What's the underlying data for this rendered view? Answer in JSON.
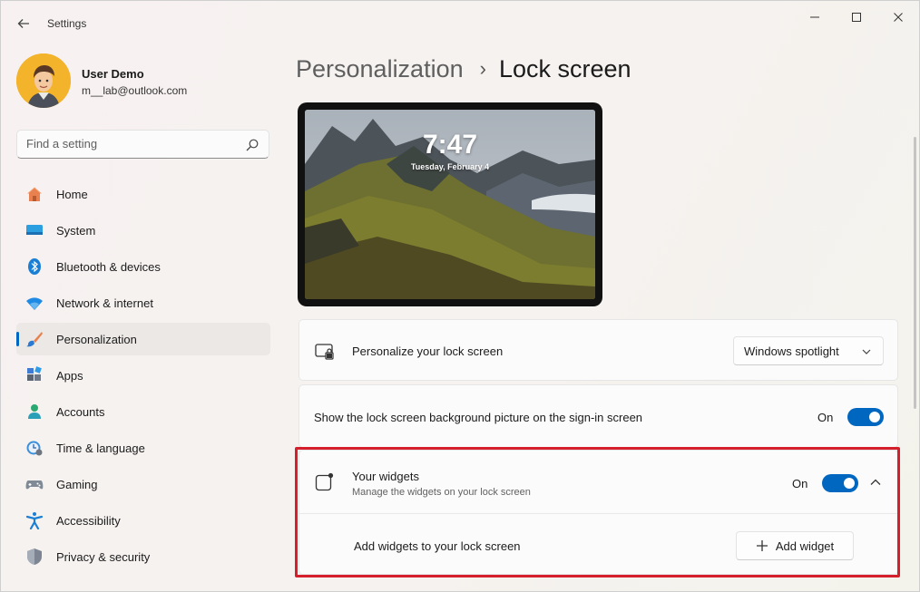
{
  "window": {
    "title": "Settings"
  },
  "profile": {
    "name": "User Demo",
    "email": "m__lab@outlook.com"
  },
  "search": {
    "placeholder": "Find a setting"
  },
  "nav": {
    "items": [
      {
        "label": "Home",
        "icon": "home-icon"
      },
      {
        "label": "System",
        "icon": "system-icon"
      },
      {
        "label": "Bluetooth & devices",
        "icon": "bluetooth-icon"
      },
      {
        "label": "Network & internet",
        "icon": "wifi-icon"
      },
      {
        "label": "Personalization",
        "icon": "brush-icon",
        "active": true
      },
      {
        "label": "Apps",
        "icon": "apps-icon"
      },
      {
        "label": "Accounts",
        "icon": "accounts-icon"
      },
      {
        "label": "Time & language",
        "icon": "clock-icon"
      },
      {
        "label": "Gaming",
        "icon": "gamepad-icon"
      },
      {
        "label": "Accessibility",
        "icon": "accessibility-icon"
      },
      {
        "label": "Privacy & security",
        "icon": "shield-icon"
      }
    ]
  },
  "breadcrumb": {
    "parent": "Personalization",
    "separator": "›",
    "current": "Lock screen"
  },
  "preview": {
    "time": "7:47",
    "date": "Tuesday, February 4"
  },
  "settings": {
    "personalize": {
      "title": "Personalize your lock screen",
      "selected": "Windows spotlight"
    },
    "background_on_signin": {
      "title": "Show the lock screen background picture on the sign-in screen",
      "state": "On"
    },
    "widgets": {
      "title": "Your widgets",
      "subtitle": "Manage the widgets on your lock screen",
      "state": "On",
      "add_row_label": "Add widgets to your lock screen",
      "add_button": "Add widget"
    }
  },
  "colors": {
    "accent": "#0067c0",
    "highlight": "#d61f2c"
  }
}
